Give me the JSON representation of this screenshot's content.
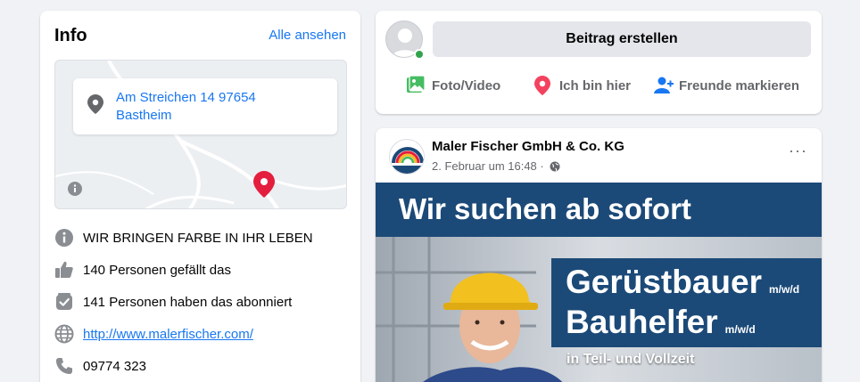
{
  "info": {
    "title": "Info",
    "see_all": "Alle ansehen",
    "address_line1": "Am Streichen 14 97654",
    "address_line2": "Bastheim",
    "rows": [
      {
        "icon": "info-icon",
        "text": "WIR BRINGEN FARBE IN IHR LEBEN"
      },
      {
        "icon": "thumbs-up-icon",
        "text": "140 Personen gefällt das"
      },
      {
        "icon": "follow-check-icon",
        "text": "141 Personen haben das abonniert"
      },
      {
        "icon": "globe-icon",
        "text": "http://www.malerfischer.com/"
      },
      {
        "icon": "phone-icon",
        "text": "09774 323"
      }
    ]
  },
  "composer": {
    "create_post": "Beitrag erstellen",
    "actions": [
      {
        "icon": "photo-video-icon",
        "label": "Foto/Video",
        "color": "#45bd62"
      },
      {
        "icon": "location-pin-icon",
        "label": "Ich bin hier",
        "color": "#f3425f"
      },
      {
        "icon": "tag-friends-icon",
        "label": "Freunde markieren",
        "color": "#1877f2"
      }
    ]
  },
  "post": {
    "page_name": "Maler Fischer GmbH & Co. KG",
    "date": "2. Februar um 16:48 ·",
    "more": "···",
    "logo_text_small": "Maler",
    "logo_text_big": "ISCHER",
    "image": {
      "headline": "Wir suchen ab sofort",
      "job1": "Gerüstbauer",
      "job2": "Bauhelfer",
      "mwd": "m/w/d",
      "subline": "in Teil- und Vollzeit"
    }
  },
  "colors": {
    "link": "#1877f2",
    "background": "#f0f2f5",
    "banner_blue": "#1c4a78",
    "online": "#31a24c"
  }
}
